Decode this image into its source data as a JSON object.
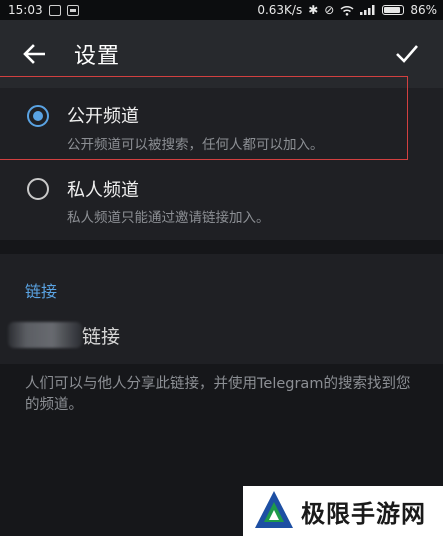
{
  "status_bar": {
    "time": "15:03",
    "network_speed": "0.63K/s",
    "battery_percent": "86%",
    "battery_level": 0.86,
    "icons": [
      "image-notification-icon",
      "app-notification-icon",
      "bluetooth-icon",
      "alarm-off-icon",
      "wifi-icon",
      "signal-icon",
      "battery-icon"
    ]
  },
  "top_bar": {
    "title": "设置",
    "back_icon": "arrow-left-icon",
    "done_icon": "checkmark-icon"
  },
  "options": {
    "public": {
      "title": "公开频道",
      "description": "公开频道可以被搜索，任何人都可以加入。",
      "selected": true
    },
    "private": {
      "title": "私人频道",
      "description": "私人频道只能通过邀请链接加入。",
      "selected": false
    }
  },
  "link_section": {
    "header": "链接",
    "input_suffix": "链接",
    "info": "人们可以与他人分享此链接，并使用Telegram的搜索找到您的频道。"
  },
  "watermark": {
    "text": "极限手游网"
  },
  "colors": {
    "accent": "#5aa3e3",
    "highlight": "#d24040",
    "top_bar_bg": "#27292d",
    "panel_bg": "#1f2024"
  }
}
